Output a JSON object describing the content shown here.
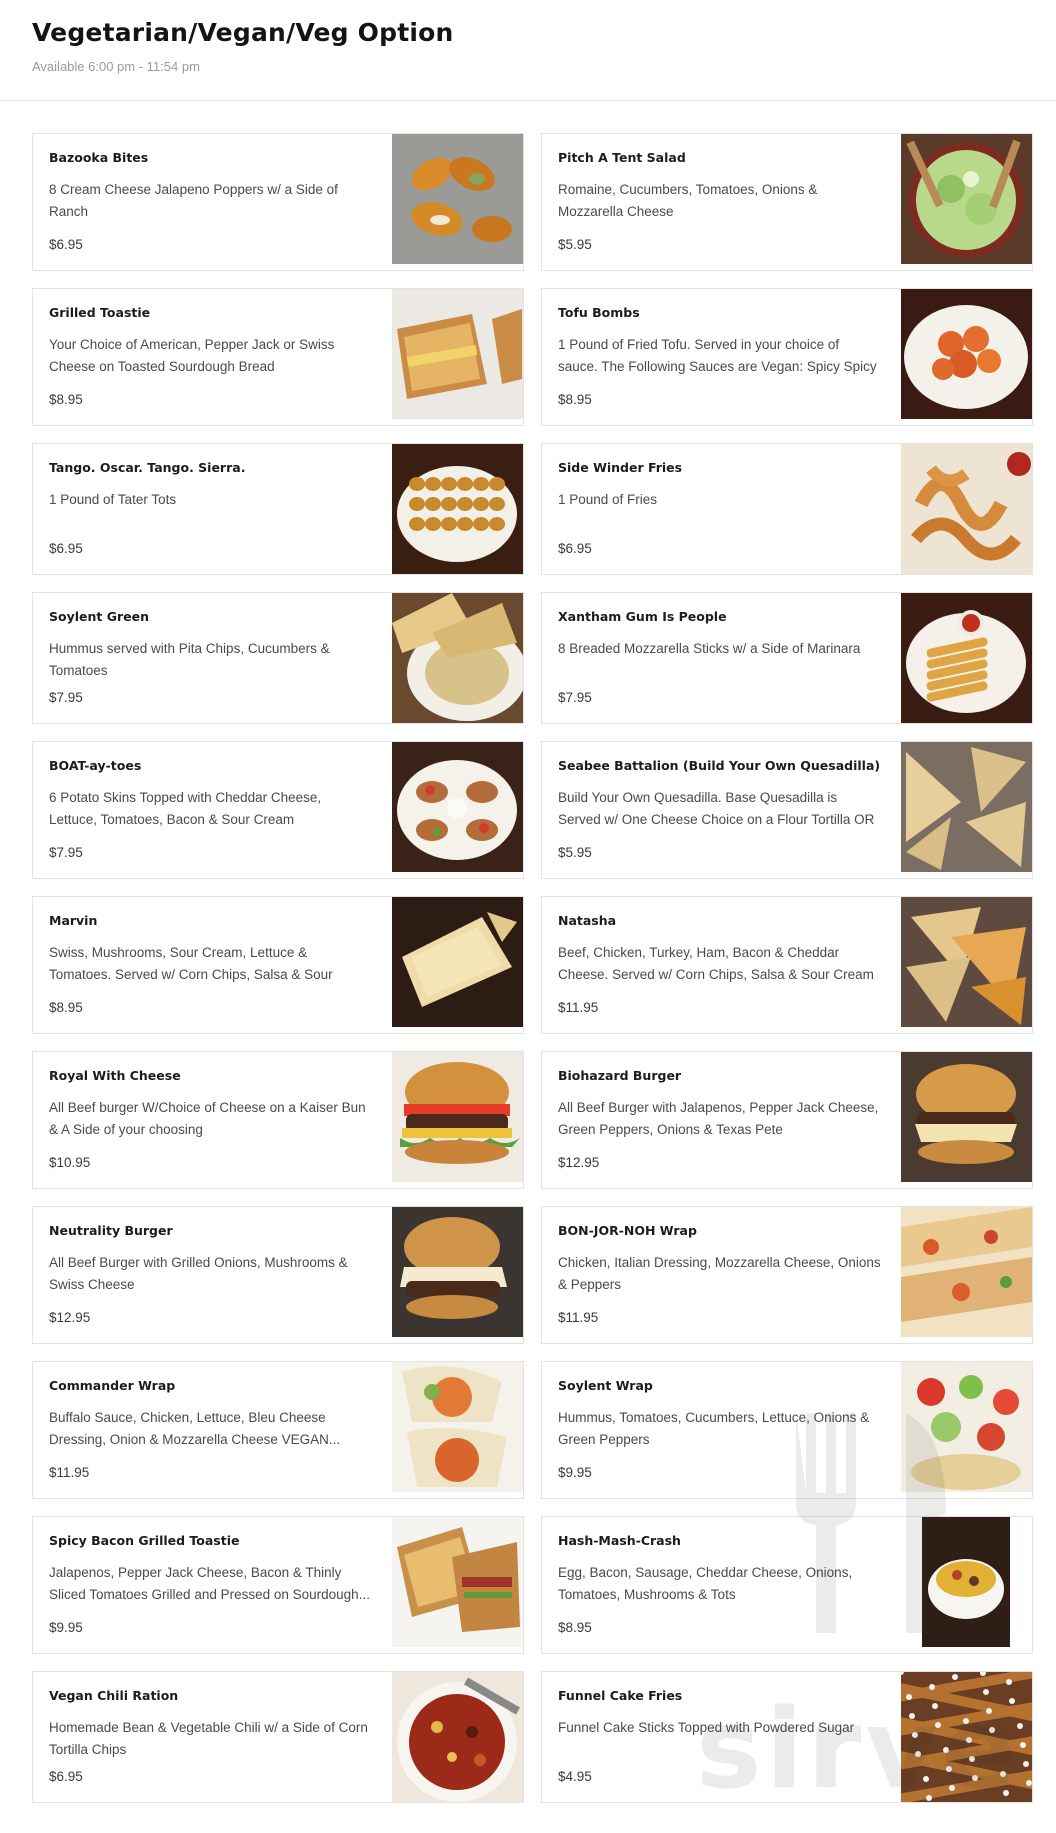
{
  "header": {
    "title": "Vegetarian/Vegan/Veg Option",
    "availability": "Available 6:00 pm - 11:54 pm"
  },
  "watermark": {
    "text": "sirve",
    "icon": "utensils-icon"
  },
  "items": [
    {
      "name": "Bazooka Bites",
      "description": "8 Cream Cheese Jalapeno Poppers w/ a Side of Ranch",
      "price": "$6.95",
      "image": "jalapeno-poppers-image"
    },
    {
      "name": "Pitch A Tent Salad",
      "description": "Romaine, Cucumbers, Tomatoes, Onions & Mozzarella Cheese",
      "price": "$5.95",
      "image": "salad-bowl-image"
    },
    {
      "name": "Grilled Toastie",
      "description": "Your Choice of American, Pepper Jack or Swiss Cheese on Toasted Sourdough Bread",
      "price": "$8.95",
      "image": "grilled-cheese-image"
    },
    {
      "name": "Tofu Bombs",
      "description": "1 Pound of Fried Tofu. Served in your choice of sauce. The Following Sauces are Vegan: Spicy Spicy BBQ...",
      "price": "$8.95",
      "image": "fried-tofu-image"
    },
    {
      "name": "Tango. Oscar. Tango. Sierra.",
      "description": "1 Pound of Tater Tots",
      "price": "$6.95",
      "image": "tater-tots-image"
    },
    {
      "name": "Side Winder Fries",
      "description": "1 Pound of Fries",
      "price": "$6.95",
      "image": "curly-fries-image"
    },
    {
      "name": "Soylent Green",
      "description": "Hummus served with Pita Chips, Cucumbers & Tomatoes",
      "price": "$7.95",
      "image": "hummus-image"
    },
    {
      "name": "Xantham Gum Is People",
      "description": "8 Breaded Mozzarella Sticks w/ a Side of Marinara",
      "price": "$7.95",
      "image": "mozzarella-sticks-image"
    },
    {
      "name": "BOAT-ay-toes",
      "description": "6 Potato Skins Topped with Cheddar Cheese, Lettuce, Tomatoes, Bacon & Sour Cream",
      "price": "$7.95",
      "image": "potato-skins-image"
    },
    {
      "name": "Seabee Battalion (Build Your Own Quesadilla)",
      "description": "Build Your Own Quesadilla. Base Quesadilla is Served w/ One Cheese Choice on a Flour Tortilla OR Two...",
      "price": "$5.95",
      "image": "quesadilla-image"
    },
    {
      "name": "Marvin",
      "description": "Swiss, Mushrooms, Sour Cream, Lettuce & Tomatoes. Served w/ Corn Chips, Salsa & Sour Cream",
      "price": "$8.95",
      "image": "quesadilla-plate-image"
    },
    {
      "name": "Natasha",
      "description": "Beef, Chicken, Turkey, Ham, Bacon & Cheddar Cheese. Served w/ Corn Chips, Salsa & Sour Cream",
      "price": "$11.95",
      "image": "loaded-quesadilla-image"
    },
    {
      "name": "Royal With Cheese",
      "description": "All Beef burger W/Choice of Cheese on a Kaiser Bun & A Side of your choosing",
      "price": "$10.95",
      "image": "cheeseburger-image"
    },
    {
      "name": "Biohazard Burger",
      "description": "All Beef Burger with Jalapenos, Pepper Jack Cheese, Green Peppers, Onions & Texas Pete",
      "price": "$12.95",
      "image": "jalapeno-burger-image"
    },
    {
      "name": "Neutrality Burger",
      "description": "All Beef Burger with Grilled Onions, Mushrooms & Swiss Cheese",
      "price": "$12.95",
      "image": "swiss-burger-image"
    },
    {
      "name": "BON-JOR-NOH Wrap",
      "description": "Chicken, Italian Dressing, Mozzarella Cheese, Onions & Peppers",
      "price": "$11.95",
      "image": "chicken-wrap-image"
    },
    {
      "name": "Commander Wrap",
      "description": "Buffalo Sauce, Chicken, Lettuce, Bleu Cheese Dressing, Onion & Mozzarella Cheese VEGAN...",
      "price": "$11.95",
      "image": "buffalo-wrap-image"
    },
    {
      "name": "Soylent Wrap",
      "description": "Hummus, Tomatoes, Cucumbers, Lettuce, Onions & Green Peppers",
      "price": "$9.95",
      "image": "veggie-wrap-image"
    },
    {
      "name": "Spicy Bacon Grilled Toastie",
      "description": "Jalapenos, Pepper Jack Cheese, Bacon & Thinly Sliced Tomatoes Grilled and Pressed on Sourdough...",
      "price": "$9.95",
      "image": "bacon-toastie-image"
    },
    {
      "name": "Hash-Mash-Crash",
      "description": "Egg, Bacon, Sausage, Cheddar Cheese, Onions, Tomatoes, Mushrooms & Tots",
      "price": "$8.95",
      "image": "hash-bowl-image"
    },
    {
      "name": "Vegan Chili Ration",
      "description": "Homemade Bean & Vegetable Chili w/ a Side of Corn Tortilla Chips",
      "price": "$6.95",
      "image": "chili-bowl-image"
    },
    {
      "name": "Funnel Cake Fries",
      "description": "Funnel Cake Sticks Topped with Powdered Sugar",
      "price": "$4.95",
      "image": "funnel-cake-image"
    }
  ]
}
